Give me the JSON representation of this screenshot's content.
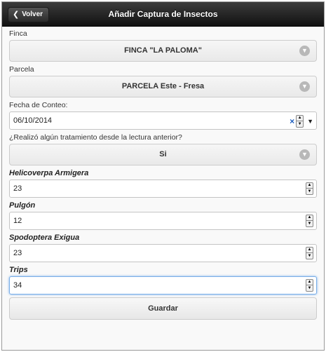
{
  "header": {
    "back_label": "Volver",
    "title": "Añadir Captura de Insectos"
  },
  "form": {
    "finca": {
      "label": "Finca",
      "value": "FINCA \"LA PALOMA\""
    },
    "parcela": {
      "label": "Parcela",
      "value": "PARCELA Este - Fresa"
    },
    "fecha": {
      "label": "Fecha de Conteo:",
      "value": "06/10/2014"
    },
    "tratamiento": {
      "label": "¿Realizó algún tratamiento desde la lectura anterior?",
      "value": "Si"
    },
    "counts": [
      {
        "label": "Helicoverpa Armigera",
        "value": "23"
      },
      {
        "label": "Pulgón",
        "value": "12"
      },
      {
        "label": "Spodoptera Exigua",
        "value": "23"
      },
      {
        "label": "Trips",
        "value": "34"
      }
    ],
    "save_label": "Guardar"
  },
  "icons": {
    "back": "chevron-left-icon",
    "select_arrow": "chevron-down-circle-icon",
    "clear": "clear-x-icon",
    "spinner": "spinner-icon",
    "dropdown": "dropdown-triangle-icon"
  },
  "colors": {
    "header_bg": "#1f1f1f",
    "focus_border": "#7aaee8",
    "clear_icon": "#1f5fbf"
  }
}
